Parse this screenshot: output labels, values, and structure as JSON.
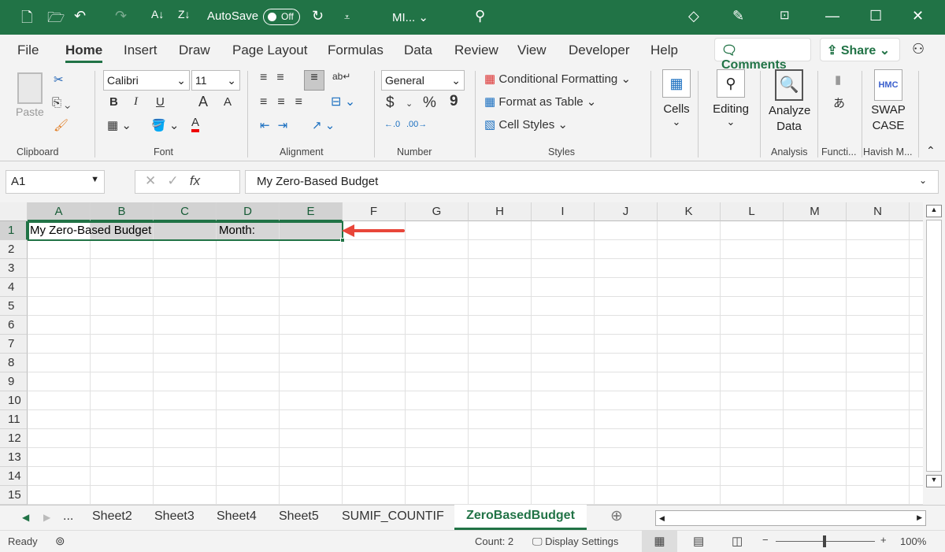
{
  "titlebar": {
    "autosave_label": "AutoSave",
    "autosave_state": "Off",
    "filename": "MI...",
    "icons": [
      "new-file-icon",
      "open-folder-icon",
      "undo-icon",
      "redo-icon",
      "sort-ascending-icon",
      "sort-descending-icon",
      "refresh-icon",
      "customize-icon",
      "search-icon",
      "diamond-icon",
      "pen-icon",
      "ribbon-display-icon",
      "minimize-icon",
      "maximize-icon",
      "close-icon"
    ]
  },
  "tabs": [
    "File",
    "Home",
    "Insert",
    "Draw",
    "Page Layout",
    "Formulas",
    "Data",
    "Review",
    "View",
    "Developer",
    "Help"
  ],
  "comments_label": "Comments",
  "share_label": "Share",
  "ribbon": {
    "clipboard": {
      "paste": "Paste",
      "group": "Clipboard"
    },
    "font": {
      "name": "Calibri",
      "size": "11",
      "bold": "B",
      "italic": "I",
      "underline": "U",
      "grow": "A",
      "shrink": "A",
      "color": "A",
      "group": "Font"
    },
    "alignment": {
      "group": "Alignment"
    },
    "number": {
      "format": "General",
      "currency": "$",
      "percent": "%",
      "comma": "9",
      "group": "Number"
    },
    "styles": {
      "cond": "Conditional Formatting",
      "table": "Format as Table",
      "cell": "Cell Styles",
      "group": "Styles"
    },
    "cells": "Cells",
    "editing": "Editing",
    "analyze": "Analyze Data",
    "analysis_group": "Analysis",
    "functions_group": "Functi...",
    "swap": "SWAP CASE",
    "hmc": "HMC",
    "havish_group": "Havish M..."
  },
  "formula_bar": {
    "name_box": "A1",
    "fx": "fx",
    "content": "My Zero-Based Budget"
  },
  "columns": [
    "A",
    "B",
    "C",
    "D",
    "E",
    "F",
    "G",
    "H",
    "I",
    "J",
    "K",
    "L",
    "M",
    "N"
  ],
  "rows": [
    "1",
    "2",
    "3",
    "4",
    "5",
    "6",
    "7",
    "8",
    "9",
    "10",
    "11",
    "12",
    "13",
    "14",
    "15"
  ],
  "cells": {
    "A1": "My Zero-Based Budget",
    "D1": "Month:"
  },
  "sheets": [
    "...",
    "Sheet2",
    "Sheet3",
    "Sheet4",
    "Sheet5",
    "SUMIF_COUNTIF",
    "ZeroBasedBudget"
  ],
  "status": {
    "ready": "Ready",
    "count": "Count: 2",
    "display": "Display Settings",
    "zoom": "100%",
    "zoom_level_percent": 100
  },
  "colors": {
    "accent": "#217346",
    "arrow": "#e8463a"
  }
}
